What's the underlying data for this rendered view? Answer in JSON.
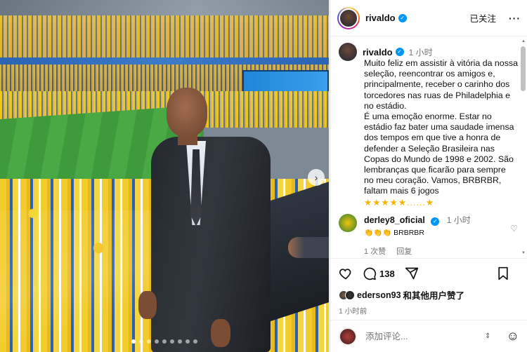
{
  "post": {
    "username": "rivaldo",
    "follow_label": "已关注",
    "more_label": "···"
  },
  "caption": {
    "username": "rivaldo",
    "time": "1 小时",
    "text": "Muito feliz em assistir à vitória da nossa seleção, reencontrar os amigos e, principalmente, receber o carinho dos torcedores nas ruas de Philadelphia e no estádio.\nÉ uma emoção enorme. Estar no estádio faz bater uma saudade imensa dos tempos em que tive a honra de defender a Seleção Brasileira nas Copas do Mundo de 1998 e 2002. São lembranças que ficarão para sempre no meu coração. Vamos, BRBRBR, faltam mais 6 jogos",
    "stars": "★★★★★......★"
  },
  "comment": {
    "username": "derley8_oficial",
    "time": "1 小时",
    "text": "👏👏👏 BRBRBR",
    "likes": "1 次赞",
    "reply": "回复"
  },
  "actions": {
    "comment_count": "138",
    "liked_by_user": "ederson93",
    "liked_by_suffix": "和其他用户赞了",
    "post_time": "1 小时前"
  },
  "add_comment": {
    "placeholder": "添加评论..."
  },
  "icons": {
    "like": "heart-icon",
    "comment": "comment-icon",
    "share": "share-icon",
    "save": "bookmark-icon",
    "emoji": "emoji-icon",
    "verified": "verified-badge-icon"
  },
  "carousel": {
    "total_slides": 9,
    "active_index": 0
  }
}
